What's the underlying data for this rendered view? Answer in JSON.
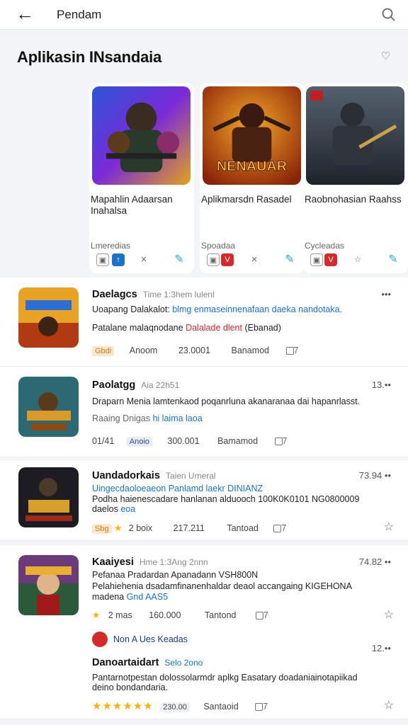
{
  "topbar": {
    "title": "Pendam"
  },
  "section": {
    "title": "Aplikasin INsandaia"
  },
  "featured": [
    {
      "name": "Mapahlin Adaarsan Inahalsa",
      "desc": "Lmeredias",
      "art_text": ""
    },
    {
      "name": "Aplikmarsdn Rasadel",
      "desc": "Spoadaa",
      "art_text": "NENAUAR"
    },
    {
      "name": "Raobnohasian Raahss",
      "desc": "Cycleadas",
      "art_text": ""
    }
  ],
  "list": [
    {
      "title": "Daelagcs",
      "meta": "Time 1:3hem lulenl",
      "line1": "Uoapang Dalakalot:",
      "line1_link": "blmg enmaseinnenafaan daeka nandotaka.",
      "line2": "Patalane malaqnodane",
      "line2_red": "Dalalade dlent",
      "line2_tail": "(Ebanad)",
      "badge": "Gbdi",
      "f1": "Anoom",
      "f2": "23.0001",
      "f3": "Banamod",
      "f4": "7",
      "more": "•••"
    },
    {
      "title": "Paolatgg",
      "meta": "Aia 22h51",
      "line1": "Draparn Menia lamtenkaod poqanrluna akanaranaa dai hapanrlasst.",
      "line2": "Raaing Dnigas",
      "line2_blue": "hi laima laoa",
      "f0": "01/41",
      "badge": "Anoio",
      "f2": "300.001",
      "f3": "Bamamod",
      "f4": "7",
      "more": "13.••"
    },
    {
      "title": "Uandadorkais",
      "meta": "Taien Umeral",
      "line1": "Uingecdaoloeaeon",
      "line1_link": "Panlamd laekr DINIANZ",
      "line2": "Podha haienescadare hanlanan alduooch 100K0K0101 NG0800009",
      "line3": "daelos",
      "line3_blue": "eoa",
      "badge": "Sbg",
      "f1": "2 boix",
      "f2": "217.211",
      "f3": "Tantoad",
      "f4": "7",
      "more": "73.94 ••"
    },
    {
      "title": "Kaaiyesi",
      "meta": "Hme 1:3Ang 2nnn",
      "line1": "Pefanaa Pradardan Apanadann VSH800N",
      "line2": "Pelahiehenia dsadamfinanenhaldar deaol accangaing KIGEHONA",
      "line3": "madena",
      "line3_blue": "Gnd AAS5",
      "f1": "2 mas",
      "f2": "160.000",
      "f3": "Tantond",
      "f4": "7",
      "more": "74.82 ••",
      "promo": "Non A Ues Keadas",
      "sub_more": "12.••",
      "sub_title": "Danoartaidart",
      "sub_meta": "Selo 2ono",
      "sub_line1": "Pantarnotpestan dolossolarmdr aplkg Easatary doadaniainotapiikad",
      "sub_line2": "deino bondandaria.",
      "sub_f2": "230.00",
      "sub_f3": "Santaoid",
      "sub_f4": "7"
    }
  ],
  "colors": {
    "accent": "#1a73c8",
    "red": "#d42a2a",
    "star": "#f5b400"
  }
}
